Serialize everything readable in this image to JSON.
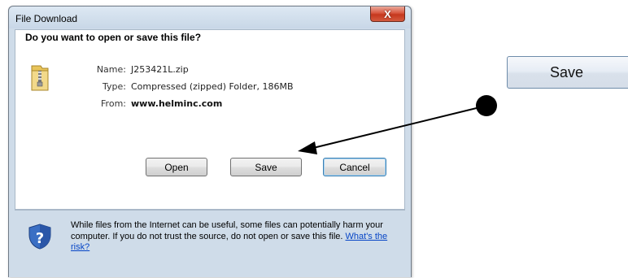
{
  "dialog": {
    "title": "File Download",
    "close_label": "X",
    "question": "Do you want to open or save this file?",
    "file": {
      "name_label": "Name:",
      "name_value": "J253421L.zip",
      "type_label": "Type:",
      "type_value": "Compressed (zipped) Folder, 186MB",
      "from_label": "From:",
      "from_value": "www.helminc.com"
    },
    "buttons": {
      "open": "Open",
      "save": "Save",
      "cancel": "Cancel"
    },
    "warning": {
      "text": "While files from the Internet can be useful, some files can potentially harm your computer. If you do not trust the source, do not open or save this file. ",
      "link": "What's the risk?"
    }
  },
  "callout": {
    "save_label": "Save"
  },
  "icons": {
    "file": "zip-folder-icon",
    "warning": "shield-question-icon",
    "close": "close-icon"
  }
}
